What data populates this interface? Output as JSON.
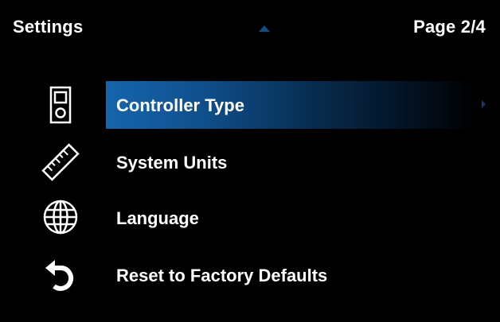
{
  "header": {
    "title": "Settings",
    "page_indicator": "Page 2/4",
    "scroll_up_icon": "triangle-up-icon"
  },
  "menu": {
    "items": [
      {
        "label": "Controller Type",
        "icon": "controller-device-icon",
        "selected": true
      },
      {
        "label": "System Units",
        "icon": "ruler-icon",
        "selected": false
      },
      {
        "label": "Language",
        "icon": "globe-icon",
        "selected": false
      },
      {
        "label": "Reset to Factory Defaults",
        "icon": "reset-arrow-icon",
        "selected": false
      }
    ]
  },
  "colors": {
    "background": "#000000",
    "highlight": "#1565ad",
    "text": "#ffffff",
    "accent_arrow": "#0a4f86"
  }
}
